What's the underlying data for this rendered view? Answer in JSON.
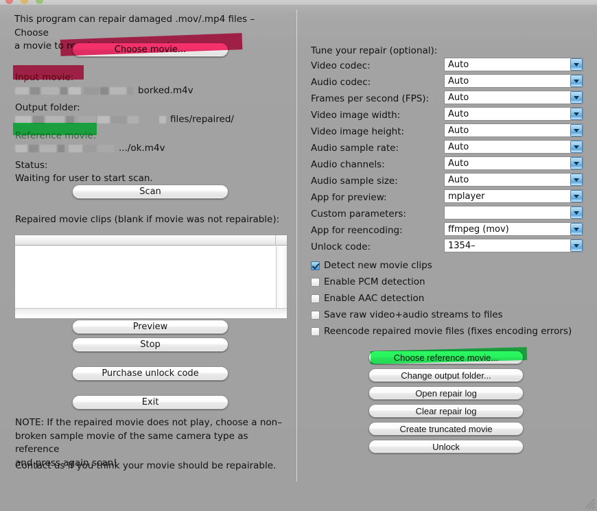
{
  "window": {
    "title": "",
    "traffic_lights": [
      "close",
      "minimize",
      "zoom"
    ]
  },
  "left": {
    "intro": "This program can repair damaged .mov/.mp4 files – Choose\na movie to repair and press scan!",
    "choose_movie_button": "Choose movie...",
    "input_movie_label": "Input movie:",
    "input_movie_value": "borked.m4v",
    "output_folder_label": "Output folder:",
    "output_folder_value": "files/repaired/",
    "reference_movie_label": "Reference movie:",
    "reference_movie_value": ".../ok.m4v",
    "status_label": "Status:",
    "status_value": "Waiting for user to start scan.",
    "scan_button": "Scan",
    "clips_label": "Repaired movie clips (blank if movie was not repairable):",
    "preview_button": "Preview",
    "stop_button": "Stop",
    "purchase_button": "Purchase unlock code",
    "exit_button": "Exit",
    "note": "NOTE: If the repaired movie does not play, choose a non–\nbroken sample movie of the same camera type as reference\nand press again scan!",
    "contact": "Contact us if you think your movie should be repairable."
  },
  "right": {
    "tune_label": "Tune your repair (optional):",
    "fields": [
      {
        "label": "Video codec:",
        "value": "Auto"
      },
      {
        "label": "Audio codec:",
        "value": "Auto"
      },
      {
        "label": "Frames per second (FPS):",
        "value": "Auto"
      },
      {
        "label": "Video image width:",
        "value": "Auto"
      },
      {
        "label": "Video image height:",
        "value": "Auto"
      },
      {
        "label": "Audio sample rate:",
        "value": "Auto"
      },
      {
        "label": "Audio channels:",
        "value": "Auto"
      },
      {
        "label": "Audio sample size:",
        "value": "Auto"
      },
      {
        "label": "App for preview:",
        "value": "mplayer"
      },
      {
        "label": "Custom parameters:",
        "value": ""
      },
      {
        "label": "App for reencoding:",
        "value": "ffmpeg (mov)"
      },
      {
        "label": "Unlock code:",
        "value": "1354–"
      }
    ],
    "checkboxes": [
      {
        "label": "Detect new movie clips",
        "checked": true
      },
      {
        "label": "Enable PCM detection",
        "checked": false
      },
      {
        "label": "Enable AAC detection",
        "checked": false
      },
      {
        "label": "Save raw video+audio streams to files",
        "checked": false
      },
      {
        "label": "Reencode repaired movie files (fixes encoding errors)",
        "checked": false
      }
    ],
    "buttons": [
      "Choose reference movie...",
      "Change output folder...",
      "Open repair log",
      "Clear repair log",
      "Create truncated movie",
      "Unlock"
    ]
  },
  "highlights": {
    "pink": "#f6316c",
    "green": "#29f960"
  }
}
